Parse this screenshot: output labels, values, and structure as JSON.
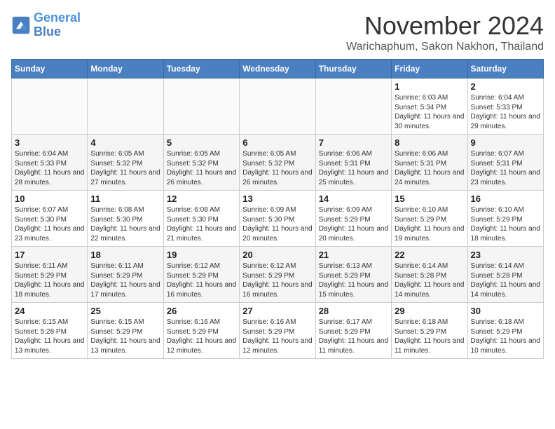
{
  "header": {
    "logo_line1": "General",
    "logo_line2": "Blue",
    "title": "November 2024",
    "subtitle": "Warichaphum, Sakon Nakhon, Thailand"
  },
  "weekdays": [
    "Sunday",
    "Monday",
    "Tuesday",
    "Wednesday",
    "Thursday",
    "Friday",
    "Saturday"
  ],
  "weeks": [
    [
      {
        "day": "",
        "info": ""
      },
      {
        "day": "",
        "info": ""
      },
      {
        "day": "",
        "info": ""
      },
      {
        "day": "",
        "info": ""
      },
      {
        "day": "",
        "info": ""
      },
      {
        "day": "1",
        "info": "Sunrise: 6:03 AM\nSunset: 5:34 PM\nDaylight: 11 hours and 30 minutes."
      },
      {
        "day": "2",
        "info": "Sunrise: 6:04 AM\nSunset: 5:33 PM\nDaylight: 11 hours and 29 minutes."
      }
    ],
    [
      {
        "day": "3",
        "info": "Sunrise: 6:04 AM\nSunset: 5:33 PM\nDaylight: 11 hours and 28 minutes."
      },
      {
        "day": "4",
        "info": "Sunrise: 6:05 AM\nSunset: 5:32 PM\nDaylight: 11 hours and 27 minutes."
      },
      {
        "day": "5",
        "info": "Sunrise: 6:05 AM\nSunset: 5:32 PM\nDaylight: 11 hours and 26 minutes."
      },
      {
        "day": "6",
        "info": "Sunrise: 6:05 AM\nSunset: 5:32 PM\nDaylight: 11 hours and 26 minutes."
      },
      {
        "day": "7",
        "info": "Sunrise: 6:06 AM\nSunset: 5:31 PM\nDaylight: 11 hours and 25 minutes."
      },
      {
        "day": "8",
        "info": "Sunrise: 6:06 AM\nSunset: 5:31 PM\nDaylight: 11 hours and 24 minutes."
      },
      {
        "day": "9",
        "info": "Sunrise: 6:07 AM\nSunset: 5:31 PM\nDaylight: 11 hours and 23 minutes."
      }
    ],
    [
      {
        "day": "10",
        "info": "Sunrise: 6:07 AM\nSunset: 5:30 PM\nDaylight: 11 hours and 23 minutes."
      },
      {
        "day": "11",
        "info": "Sunrise: 6:08 AM\nSunset: 5:30 PM\nDaylight: 11 hours and 22 minutes."
      },
      {
        "day": "12",
        "info": "Sunrise: 6:08 AM\nSunset: 5:30 PM\nDaylight: 11 hours and 21 minutes."
      },
      {
        "day": "13",
        "info": "Sunrise: 6:09 AM\nSunset: 5:30 PM\nDaylight: 11 hours and 20 minutes."
      },
      {
        "day": "14",
        "info": "Sunrise: 6:09 AM\nSunset: 5:29 PM\nDaylight: 11 hours and 20 minutes."
      },
      {
        "day": "15",
        "info": "Sunrise: 6:10 AM\nSunset: 5:29 PM\nDaylight: 11 hours and 19 minutes."
      },
      {
        "day": "16",
        "info": "Sunrise: 6:10 AM\nSunset: 5:29 PM\nDaylight: 11 hours and 18 minutes."
      }
    ],
    [
      {
        "day": "17",
        "info": "Sunrise: 6:11 AM\nSunset: 5:29 PM\nDaylight: 11 hours and 18 minutes."
      },
      {
        "day": "18",
        "info": "Sunrise: 6:11 AM\nSunset: 5:29 PM\nDaylight: 11 hours and 17 minutes."
      },
      {
        "day": "19",
        "info": "Sunrise: 6:12 AM\nSunset: 5:29 PM\nDaylight: 11 hours and 16 minutes."
      },
      {
        "day": "20",
        "info": "Sunrise: 6:12 AM\nSunset: 5:29 PM\nDaylight: 11 hours and 16 minutes."
      },
      {
        "day": "21",
        "info": "Sunrise: 6:13 AM\nSunset: 5:29 PM\nDaylight: 11 hours and 15 minutes."
      },
      {
        "day": "22",
        "info": "Sunrise: 6:14 AM\nSunset: 5:28 PM\nDaylight: 11 hours and 14 minutes."
      },
      {
        "day": "23",
        "info": "Sunrise: 6:14 AM\nSunset: 5:28 PM\nDaylight: 11 hours and 14 minutes."
      }
    ],
    [
      {
        "day": "24",
        "info": "Sunrise: 6:15 AM\nSunset: 5:28 PM\nDaylight: 11 hours and 13 minutes."
      },
      {
        "day": "25",
        "info": "Sunrise: 6:15 AM\nSunset: 5:29 PM\nDaylight: 11 hours and 13 minutes."
      },
      {
        "day": "26",
        "info": "Sunrise: 6:16 AM\nSunset: 5:29 PM\nDaylight: 11 hours and 12 minutes."
      },
      {
        "day": "27",
        "info": "Sunrise: 6:16 AM\nSunset: 5:29 PM\nDaylight: 11 hours and 12 minutes."
      },
      {
        "day": "28",
        "info": "Sunrise: 6:17 AM\nSunset: 5:29 PM\nDaylight: 11 hours and 11 minutes."
      },
      {
        "day": "29",
        "info": "Sunrise: 6:18 AM\nSunset: 5:29 PM\nDaylight: 11 hours and 11 minutes."
      },
      {
        "day": "30",
        "info": "Sunrise: 6:18 AM\nSunset: 5:29 PM\nDaylight: 11 hours and 10 minutes."
      }
    ]
  ]
}
